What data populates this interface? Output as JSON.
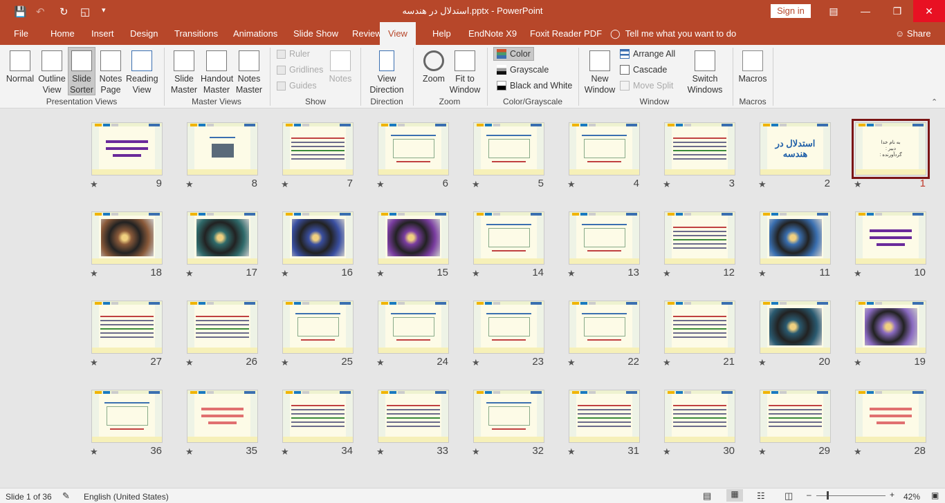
{
  "app": {
    "title": "استدلال در هندسه.pptx  -  PowerPoint",
    "sign_in": "Sign in",
    "share": "Share",
    "tell_me": "Tell me what you want to do"
  },
  "tabs": [
    "File",
    "Home",
    "Insert",
    "Design",
    "Transitions",
    "Animations",
    "Slide Show",
    "Review",
    "View",
    "Help",
    "EndNote X9",
    "Foxit Reader PDF"
  ],
  "active_tab": "View",
  "ribbon": {
    "presentation_views": {
      "label": "Presentation Views",
      "items": [
        "Normal",
        "Outline View",
        "Slide Sorter",
        "Notes Page",
        "Reading View"
      ],
      "selected": "Slide Sorter"
    },
    "master_views": {
      "label": "Master Views",
      "items": [
        "Slide Master",
        "Handout Master",
        "Notes Master"
      ]
    },
    "show": {
      "label": "Show",
      "checkboxes": [
        {
          "label": "Ruler",
          "checked": false
        },
        {
          "label": "Gridlines",
          "checked": false
        },
        {
          "label": "Guides",
          "checked": false
        }
      ],
      "notes": "Notes"
    },
    "direction": {
      "label": "Direction",
      "button": "View Direction"
    },
    "zoom": {
      "label": "Zoom",
      "items": [
        "Zoom",
        "Fit to Window"
      ]
    },
    "color": {
      "label": "Color/Grayscale",
      "items": [
        "Color",
        "Grayscale",
        "Black and White"
      ],
      "selected": "Color"
    },
    "window": {
      "label": "Window",
      "new_window": "New Window",
      "arrange_all": "Arrange All",
      "cascade": "Cascade",
      "move_split": "Move Split",
      "switch_windows": "Switch Windows"
    },
    "macros": {
      "label": "Macros",
      "button": "Macros"
    }
  },
  "slides": [
    {
      "n": "1",
      "kind": "title",
      "lines": [
        "به نام خدا",
        "دبیر :",
        "گردآورنده :"
      ]
    },
    {
      "n": "2",
      "kind": "headline",
      "lines": [
        "استدلال در هندسه"
      ]
    },
    {
      "n": "3",
      "kind": "text"
    },
    {
      "n": "4",
      "kind": "diagram"
    },
    {
      "n": "5",
      "kind": "diagram"
    },
    {
      "n": "6",
      "kind": "diagram"
    },
    {
      "n": "7",
      "kind": "text"
    },
    {
      "n": "8",
      "kind": "textimg"
    },
    {
      "n": "9",
      "kind": "purple"
    },
    {
      "n": "10",
      "kind": "purple"
    },
    {
      "n": "11",
      "kind": "image",
      "color": "#3a6fb0"
    },
    {
      "n": "12",
      "kind": "text"
    },
    {
      "n": "13",
      "kind": "diagram"
    },
    {
      "n": "14",
      "kind": "diagram"
    },
    {
      "n": "15",
      "kind": "image",
      "color": "#7a3da0"
    },
    {
      "n": "16",
      "kind": "image",
      "color": "#3a4fa0"
    },
    {
      "n": "17",
      "kind": "image",
      "color": "#2f6a6a"
    },
    {
      "n": "18",
      "kind": "image",
      "color": "#8a5a3a"
    },
    {
      "n": "19",
      "kind": "image",
      "color": "#8a6ac0"
    },
    {
      "n": "20",
      "kind": "image",
      "color": "#2a5a70"
    },
    {
      "n": "21",
      "kind": "text"
    },
    {
      "n": "22",
      "kind": "diagram"
    },
    {
      "n": "23",
      "kind": "diagram"
    },
    {
      "n": "24",
      "kind": "diagram"
    },
    {
      "n": "25",
      "kind": "diagram"
    },
    {
      "n": "26",
      "kind": "text"
    },
    {
      "n": "27",
      "kind": "text"
    },
    {
      "n": "28",
      "kind": "pink"
    },
    {
      "n": "29",
      "kind": "text"
    },
    {
      "n": "30",
      "kind": "text"
    },
    {
      "n": "31",
      "kind": "text"
    },
    {
      "n": "32",
      "kind": "diagram"
    },
    {
      "n": "33",
      "kind": "text"
    },
    {
      "n": "34",
      "kind": "text"
    },
    {
      "n": "35",
      "kind": "pink"
    },
    {
      "n": "36",
      "kind": "diagram"
    }
  ],
  "selected_slide": "1",
  "status": {
    "slide_info": "Slide 1 of 36",
    "language": "English (United States)",
    "zoom": "42%"
  },
  "colors": {
    "accent": "#b7472a",
    "selection": "#7b1515"
  }
}
